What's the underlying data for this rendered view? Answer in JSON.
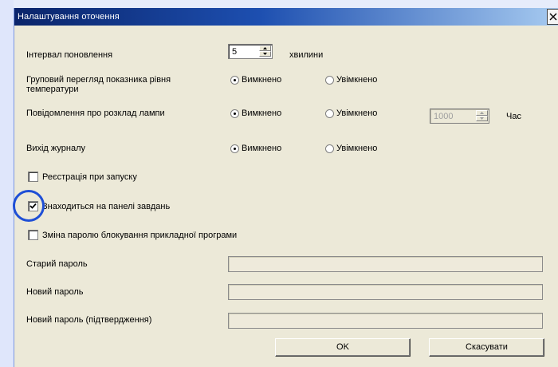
{
  "window": {
    "title": "Налаштування оточення"
  },
  "refresh_interval": {
    "label": "Інтервал поновлення",
    "value": "5",
    "unit": "хвилини"
  },
  "group_temp_view": {
    "label_line1": "Груповий перегляд показника рівня",
    "label_line2": "температури",
    "off_label": "Вимкнено",
    "on_label": "Увімкнено",
    "selected": "off"
  },
  "lamp_schedule": {
    "label": "Повідомлення про розклад лампи",
    "off_label": "Вимкнено",
    "on_label": "Увімкнено",
    "selected": "off",
    "hours_value": "1000",
    "hours_unit": "Час"
  },
  "log_output": {
    "label": "Вихід журналу",
    "off_label": "Вимкнено",
    "on_label": "Увімкнено",
    "selected": "off"
  },
  "checkboxes": {
    "register_startup": {
      "label": "Реєстрація при запуску",
      "checked": false
    },
    "on_taskbar": {
      "label": "Знаходиться на панелі завдань",
      "checked": true
    },
    "change_lock_password": {
      "label": "Зміна паролю блокування прикладної програми",
      "checked": false
    }
  },
  "passwords": {
    "old_label": "Старий пароль",
    "new_label": "Новий пароль",
    "confirm_label": "Новий пароль (підтвердження)"
  },
  "buttons": {
    "ok": "OK",
    "cancel": "Скасувати"
  },
  "colors": {
    "title_bar_start": "#0a246a",
    "title_bar_end": "#a6caf0",
    "dialog_bg": "#ece9d8",
    "highlight": "#1f4fd6"
  }
}
